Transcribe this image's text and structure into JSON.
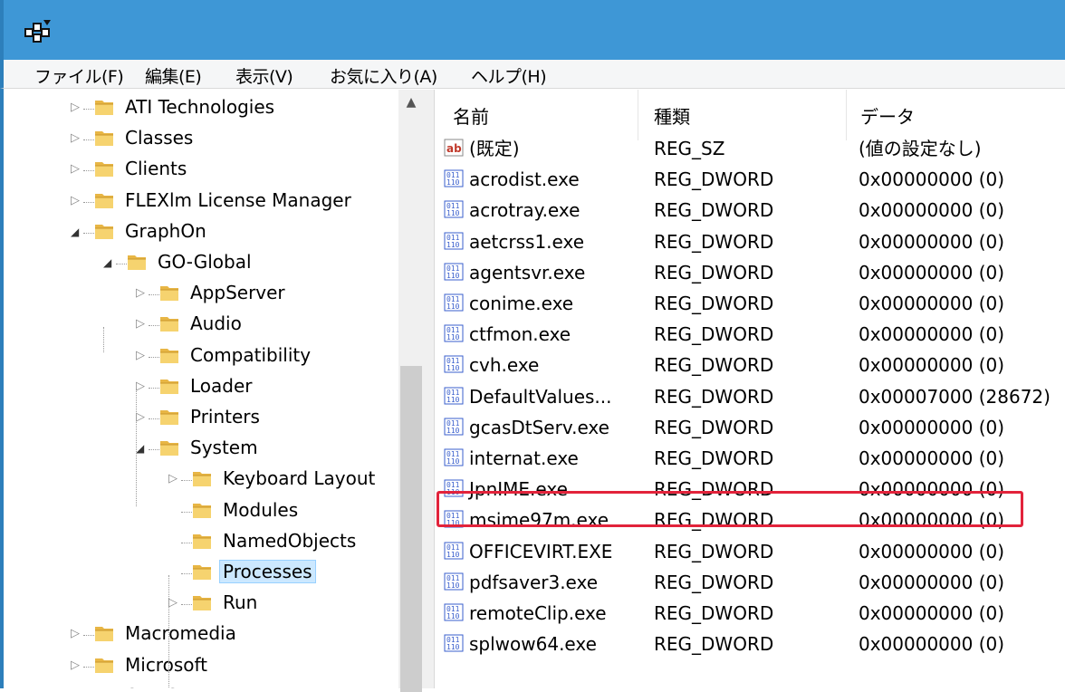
{
  "menu": [
    "ファイル(F)",
    "編集(E)",
    "表示(V)",
    "お気に入り(A)",
    "ヘルプ(H)"
  ],
  "tree": [
    {
      "label": "ATI Technologies",
      "expander": "collapsed"
    },
    {
      "label": "Classes",
      "expander": "collapsed"
    },
    {
      "label": "Clients",
      "expander": "collapsed"
    },
    {
      "label": "FLEXlm License Manager",
      "expander": "collapsed"
    },
    {
      "label": "GraphOn",
      "expander": "expanded"
    },
    {
      "label": "GO-Global",
      "expander": "expanded"
    },
    {
      "label": "AppServer",
      "expander": "collapsed"
    },
    {
      "label": "Audio",
      "expander": "collapsed"
    },
    {
      "label": "Compatibility",
      "expander": "collapsed"
    },
    {
      "label": "Loader",
      "expander": "collapsed"
    },
    {
      "label": "Printers",
      "expander": "collapsed"
    },
    {
      "label": "System",
      "expander": "expanded"
    },
    {
      "label": "Keyboard Layout",
      "expander": "collapsed"
    },
    {
      "label": "Modules",
      "expander": "none"
    },
    {
      "label": "NamedObjects",
      "expander": "none"
    },
    {
      "label": "Processes",
      "expander": "none",
      "selected": true
    },
    {
      "label": "Run",
      "expander": "collapsed"
    },
    {
      "label": "Macromedia",
      "expander": "collapsed"
    },
    {
      "label": "Microsoft",
      "expander": "collapsed"
    },
    {
      "label": "ODBC",
      "expander": "collapsed"
    }
  ],
  "columns": {
    "name": "名前",
    "type": "種類",
    "data": "データ"
  },
  "values": [
    {
      "name": "(既定)",
      "type": "REG_SZ",
      "data": "(値の設定なし)",
      "icon": "string-value-icon"
    },
    {
      "name": "acrodist.exe",
      "type": "REG_DWORD",
      "data": "0x00000000 (0)",
      "icon": "dword-value-icon"
    },
    {
      "name": "acrotray.exe",
      "type": "REG_DWORD",
      "data": "0x00000000 (0)",
      "icon": "dword-value-icon"
    },
    {
      "name": "aetcrss1.exe",
      "type": "REG_DWORD",
      "data": "0x00000000 (0)",
      "icon": "dword-value-icon"
    },
    {
      "name": "agentsvr.exe",
      "type": "REG_DWORD",
      "data": "0x00000000 (0)",
      "icon": "dword-value-icon"
    },
    {
      "name": "conime.exe",
      "type": "REG_DWORD",
      "data": "0x00000000 (0)",
      "icon": "dword-value-icon"
    },
    {
      "name": "ctfmon.exe",
      "type": "REG_DWORD",
      "data": "0x00000000 (0)",
      "icon": "dword-value-icon"
    },
    {
      "name": "cvh.exe",
      "type": "REG_DWORD",
      "data": "0x00000000 (0)",
      "icon": "dword-value-icon"
    },
    {
      "name": "DefaultValues...",
      "type": "REG_DWORD",
      "data": "0x00007000 (28672)",
      "icon": "dword-value-icon"
    },
    {
      "name": "gcasDtServ.exe",
      "type": "REG_DWORD",
      "data": "0x00000000 (0)",
      "icon": "dword-value-icon"
    },
    {
      "name": "internat.exe",
      "type": "REG_DWORD",
      "data": "0x00000000 (0)",
      "icon": "dword-value-icon"
    },
    {
      "name": "JpnIME.exe",
      "type": "REG_DWORD",
      "data": "0x00000000 (0)",
      "icon": "dword-value-icon",
      "highlighted": true
    },
    {
      "name": "msime97m.exe",
      "type": "REG_DWORD",
      "data": "0x00000000 (0)",
      "icon": "dword-value-icon"
    },
    {
      "name": "OFFICEVIRT.EXE",
      "type": "REG_DWORD",
      "data": "0x00000000 (0)",
      "icon": "dword-value-icon"
    },
    {
      "name": "pdfsaver3.exe",
      "type": "REG_DWORD",
      "data": "0x00000000 (0)",
      "icon": "dword-value-icon"
    },
    {
      "name": "remoteClip.exe",
      "type": "REG_DWORD",
      "data": "0x00000000 (0)",
      "icon": "dword-value-icon"
    },
    {
      "name": "splwow64.exe",
      "type": "REG_DWORD",
      "data": "0x00000000 (0)",
      "icon": "dword-value-icon"
    }
  ],
  "colors": {
    "titlebar": "#3e97d6",
    "highlight": "#e2233b",
    "selection": "#cce8ff"
  }
}
